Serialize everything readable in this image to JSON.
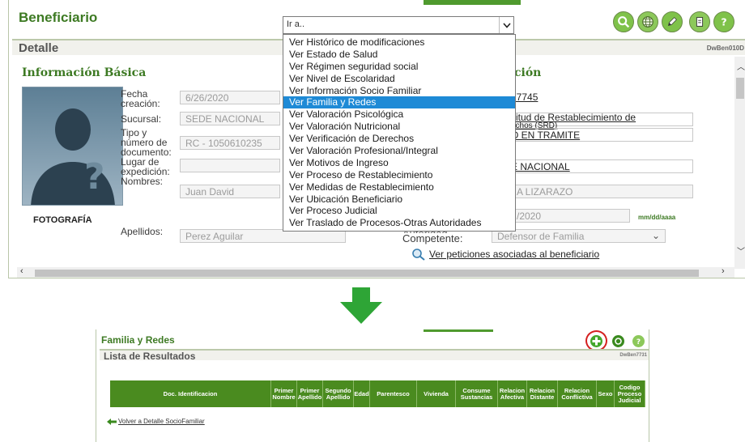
{
  "top": {
    "title": "Beneficiario",
    "detalle_label": "Detalle",
    "detalle_code": "DwBen010D",
    "info_basica": "Información Básica",
    "right_section": "ción",
    "photo_caption": "FOTOGRAFÍA",
    "fields": {
      "fecha_label_1": "Fecha",
      "fecha_label_2": "creación:",
      "fecha_value": "6/26/2020",
      "sucursal_label": "Sucursal:",
      "sucursal_value": "SEDE NACIONAL",
      "tipo_label_1": "Tipo y",
      "tipo_label_2": "número de",
      "tipo_label_3": "documento:",
      "tipo_value": "RC   - 1050610235",
      "lugar_label_1": "Lugar de",
      "lugar_label_2": "expedición:",
      "lugar_value": "",
      "nombres_label": "Nombres:",
      "nombres_value": "Juan  David",
      "apellidos_label": "Apellidos:",
      "apellidos_value": "Perez Aguilar"
    },
    "right": {
      "num": "17745",
      "solicitud_line1": "citud de Restablecimiento de",
      "solicitud_line2": "echos (SRD)",
      "estado": "O EN TRAMITE",
      "sede": "E NACIONAL",
      "nombre": "A LIZARAZO",
      "fecha": "/2020",
      "fecha_hint": "mm/dd/aaaa",
      "autoridad_label_1": "Autoridad",
      "autoridad_label_2": "Competente:",
      "autoridad_value": "Defensor de Familia",
      "peticiones_link": "Ver peticiones asociadas al beneficiario"
    },
    "select_value": "Ir a..",
    "dropdown_options": [
      "Ver Histórico de modificaciones",
      "Ver Estado de Salud",
      "Ver Régimen seguridad social",
      "Ver Nivel de Escolaridad",
      "Ver Información Socio Familiar",
      "Ver Familia y Redes",
      "Ver Valoración Psicológica",
      "Ver Valoración Nutricional",
      "Ver Verificación de Derechos",
      "Ver Valoración Profesional/Integral",
      "Ver Motivos de Ingreso",
      "Ver Proceso de Restablecimiento",
      "Ver Medidas de Restablecimiento",
      "Ver Ubicación Beneficiario",
      "Ver Proceso Judicial",
      "Ver Traslado de Procesos-Otras Autoridades"
    ],
    "selected_option_index": 5
  },
  "bottom": {
    "title": "Familia y Redes",
    "lista_label": "Lista de Resultados",
    "lista_code": "DwBen7731",
    "columns": [
      "Doc. Identificacion",
      "Primer Nombre",
      "Primer Apellido",
      "Segundo Apellido",
      "Edad",
      "Parentesco",
      "Vivienda",
      "Consume Sustancias",
      "Relacion Afectiva",
      "Relacion Distante",
      "Relacion Conflictiva",
      "Sexo",
      "Codigo Proceso Judicial"
    ],
    "back_link": "Volver a Detalle SocioFamiliar"
  },
  "colors": {
    "brand_green": "#3d7a23",
    "header_green": "#4a8b1f",
    "selected_blue": "#1e8ad6",
    "arrow_green": "#2ea536",
    "highlight_red": "#d42020"
  }
}
